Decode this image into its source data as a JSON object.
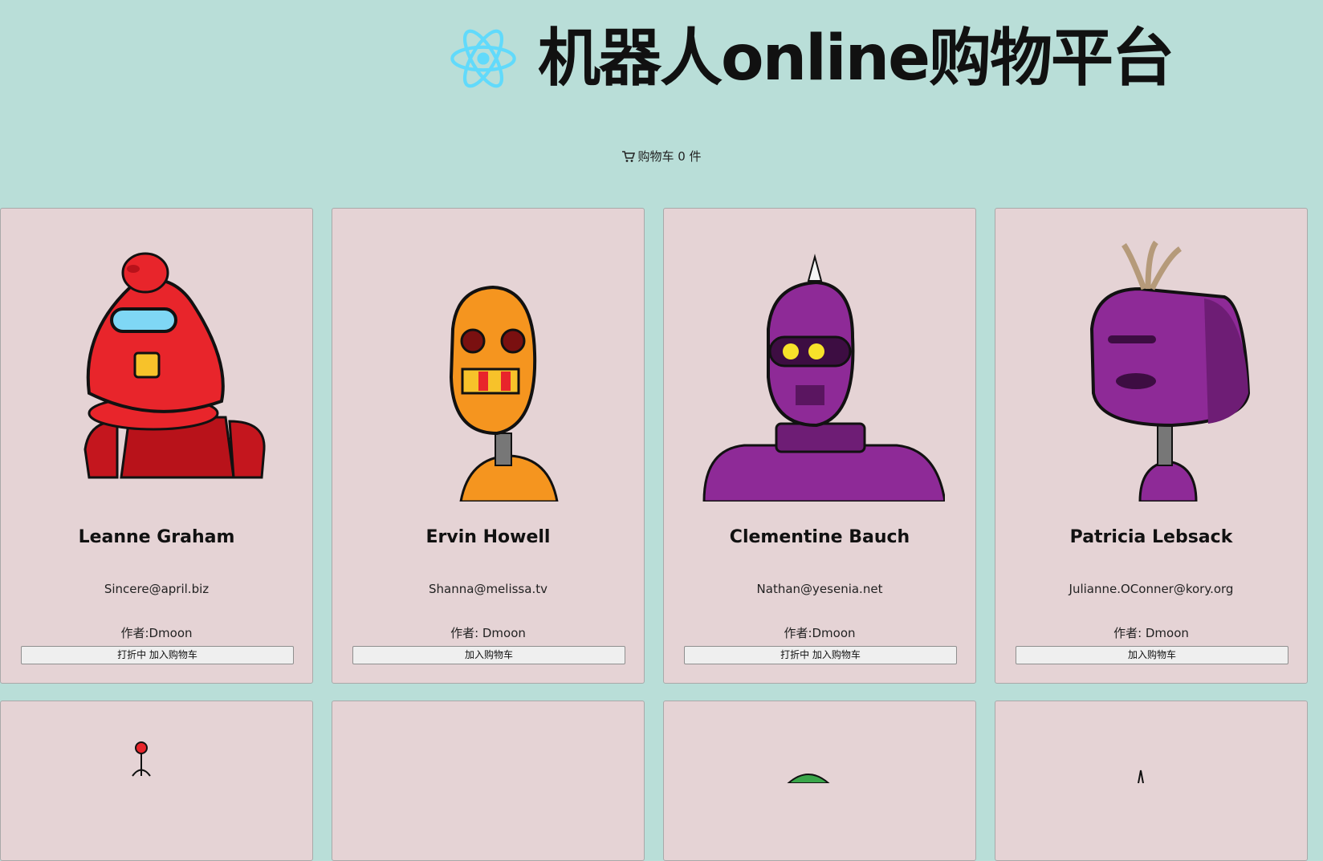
{
  "header": {
    "title": "机器人online购物平台",
    "logo_icon": "react-atom-icon",
    "logo_color": "#61dafb"
  },
  "cart": {
    "label": "购物车 0 件",
    "icon": "shopping-cart-icon"
  },
  "robots": [
    {
      "name": "Leanne Graham",
      "email": "Sincere@april.biz",
      "author": "作者:Dmoon",
      "button": "打折中 加入购物车",
      "color": "#e8252b"
    },
    {
      "name": "Ervin Howell",
      "email": "Shanna@melissa.tv",
      "author": "作者: Dmoon",
      "button": "加入购物车",
      "color": "#f5951f"
    },
    {
      "name": "Clementine Bauch",
      "email": "Nathan@yesenia.net",
      "author": "作者:Dmoon",
      "button": "打折中 加入购物车",
      "color": "#8e2a97"
    },
    {
      "name": "Patricia Lebsack",
      "email": "Julianne.OConner@kory.org",
      "author": "作者: Dmoon",
      "button": "加入购物车",
      "color": "#8e2a97"
    }
  ],
  "colors": {
    "background": "#b9ded8",
    "card": "#e5d3d5"
  }
}
